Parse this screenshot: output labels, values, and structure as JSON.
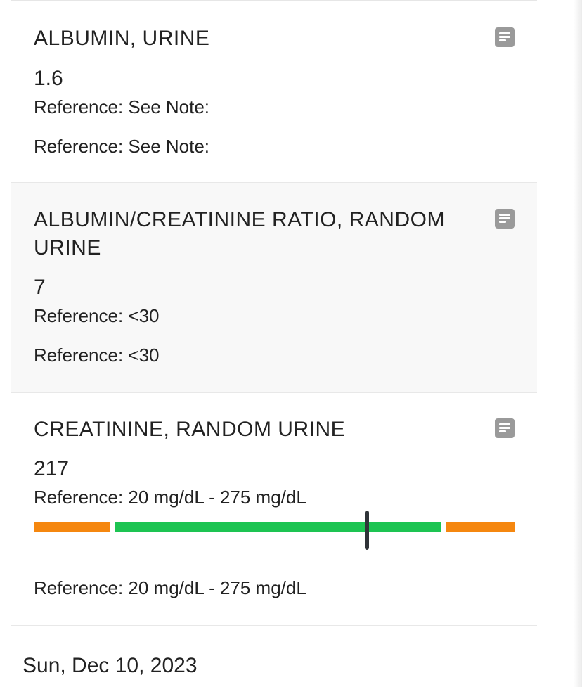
{
  "results": [
    {
      "title": "ALBUMIN, URINE",
      "value": "1.6",
      "reference_1": "Reference: See Note:",
      "reference_2": "Reference: See Note:",
      "note_icon": "note-icon"
    },
    {
      "title": "ALBUMIN/CREATININE RATIO, RANDOM URINE",
      "value": "7",
      "reference_1": "Reference: <30",
      "reference_2": "Reference: <30",
      "note_icon": "note-icon"
    },
    {
      "title": "CREATININE, RANDOM URINE",
      "value": "217",
      "reference_1": "Reference: 20 mg/dL - 275 mg/dL",
      "reference_2": "Reference: 20 mg/dL - 275 mg/dL",
      "note_icon": "note-icon",
      "range": {
        "low": 20,
        "high": 275,
        "result": 217,
        "colors": {
          "out_of_range": "#f5870f",
          "in_range": "#1dc452",
          "marker": "#2f3338"
        }
      }
    }
  ],
  "date_header": "Sun, Dec 10, 2023"
}
